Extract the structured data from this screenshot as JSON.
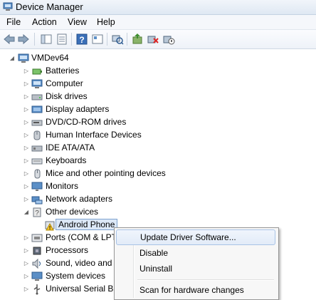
{
  "window": {
    "title": "Device Manager"
  },
  "menu": [
    "File",
    "Action",
    "View",
    "Help"
  ],
  "toolbar": [
    "back-icon",
    "forward-icon",
    "properties-panel-icon",
    "view-icon",
    "help-icon",
    "resources-icon",
    "scan-hardware-icon",
    "update-driver-icon",
    "uninstall-icon",
    "disable-icon"
  ],
  "tree": {
    "root": "VMDev64",
    "items": [
      {
        "label": "Batteries",
        "icon": "battery-icon",
        "expander": "▷"
      },
      {
        "label": "Computer",
        "icon": "computer-icon",
        "expander": "▷"
      },
      {
        "label": "Disk drives",
        "icon": "disk-icon",
        "expander": "▷"
      },
      {
        "label": "Display adapters",
        "icon": "display-adapter-icon",
        "expander": "▷"
      },
      {
        "label": "DVD/CD-ROM drives",
        "icon": "dvd-icon",
        "expander": "▷"
      },
      {
        "label": "Human Interface Devices",
        "icon": "hid-icon",
        "expander": "▷"
      },
      {
        "label": "IDE ATA/ATA",
        "icon": "ide-icon",
        "expander": "▷"
      },
      {
        "label": "Keyboards",
        "icon": "keyboard-icon",
        "expander": "▷"
      },
      {
        "label": "Mice and other pointing devices",
        "icon": "mouse-icon",
        "expander": "▷"
      },
      {
        "label": "Monitors",
        "icon": "monitor-icon",
        "expander": "▷"
      },
      {
        "label": "Network adapters",
        "icon": "network-icon",
        "expander": "▷"
      },
      {
        "label": "Other devices",
        "icon": "other-devices-icon",
        "expander": "◢"
      },
      {
        "label": "Android Phone",
        "icon": "warning-device-icon",
        "expander": ""
      },
      {
        "label": "Ports (COM & LPT",
        "icon": "ports-icon",
        "expander": "▷"
      },
      {
        "label": "Processors",
        "icon": "processor-icon",
        "expander": "▷"
      },
      {
        "label": "Sound, video and",
        "icon": "sound-icon",
        "expander": "▷"
      },
      {
        "label": "System devices",
        "icon": "system-icon",
        "expander": "▷"
      },
      {
        "label": "Universal Serial Bu",
        "icon": "usb-icon",
        "expander": "▷"
      }
    ]
  },
  "context_menu": {
    "items": [
      "Update Driver Software...",
      "Disable",
      "Uninstall",
      "Scan for hardware changes"
    ]
  }
}
